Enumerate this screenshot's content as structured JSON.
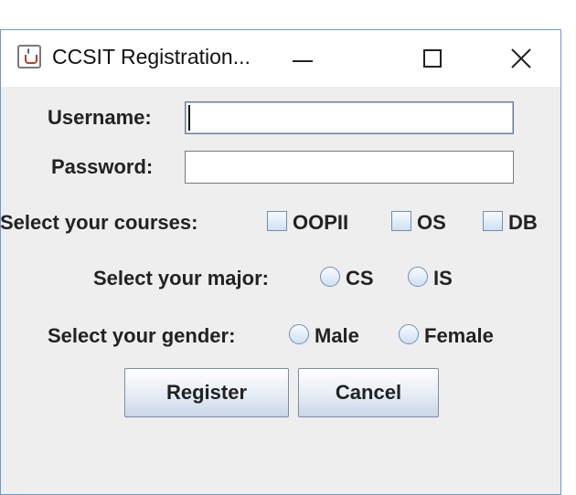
{
  "window": {
    "title": "CCSIT Registration..."
  },
  "form": {
    "username_label": "Username:",
    "username_value": "",
    "password_label": "Password:",
    "password_value": "",
    "courses_label": "Select your courses:",
    "courses": [
      {
        "label": "OOPII",
        "checked": false
      },
      {
        "label": "OS",
        "checked": false
      },
      {
        "label": "DB",
        "checked": false
      }
    ],
    "major_label": "Select your major:",
    "majors": [
      {
        "label": "CS",
        "selected": false
      },
      {
        "label": "IS",
        "selected": false
      }
    ],
    "gender_label": "Select your gender:",
    "genders": [
      {
        "label": "Male",
        "selected": false
      },
      {
        "label": "Female",
        "selected": false
      }
    ],
    "register_button": "Register",
    "cancel_button": "Cancel"
  },
  "colors": {
    "window_border": "#6b9bd1",
    "content_background": "#eeeeee",
    "title_background": "#ffffff"
  },
  "icons": {
    "app": "java-cup-icon",
    "minimize": "minimize-icon",
    "maximize": "maximize-icon",
    "close": "close-icon"
  }
}
